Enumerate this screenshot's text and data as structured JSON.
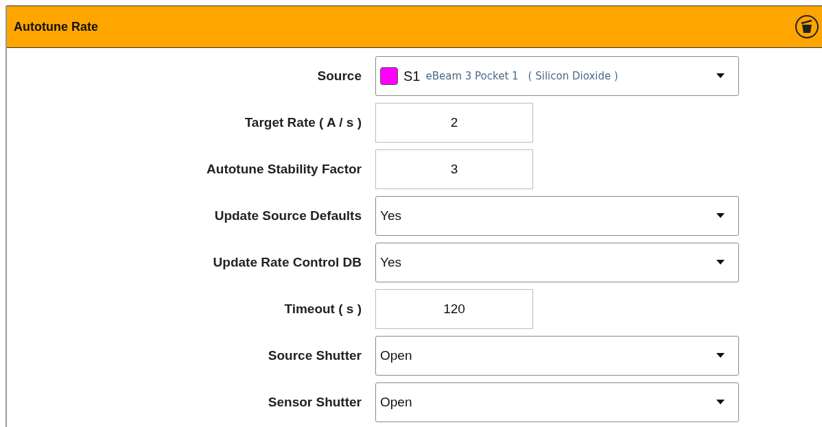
{
  "panel": {
    "title": "Autotune Rate"
  },
  "fields": [
    {
      "label": "Source",
      "kind": "source",
      "code": "S1",
      "detail": "eBeam 3 Pocket 1",
      "material": "( Silicon Dioxide )",
      "color": "#ff00ff"
    },
    {
      "label": "Target Rate ( A / s )",
      "kind": "input",
      "value": "2"
    },
    {
      "label": "Autotune Stability Factor",
      "kind": "input",
      "value": "3"
    },
    {
      "label": "Update Source Defaults",
      "kind": "select",
      "value": "Yes"
    },
    {
      "label": "Update Rate Control DB",
      "kind": "select",
      "value": "Yes"
    },
    {
      "label": "Timeout ( s )",
      "kind": "input",
      "value": "120"
    },
    {
      "label": "Source Shutter",
      "kind": "select",
      "value": "Open"
    },
    {
      "label": "Sensor Shutter",
      "kind": "select",
      "value": "Open"
    }
  ]
}
